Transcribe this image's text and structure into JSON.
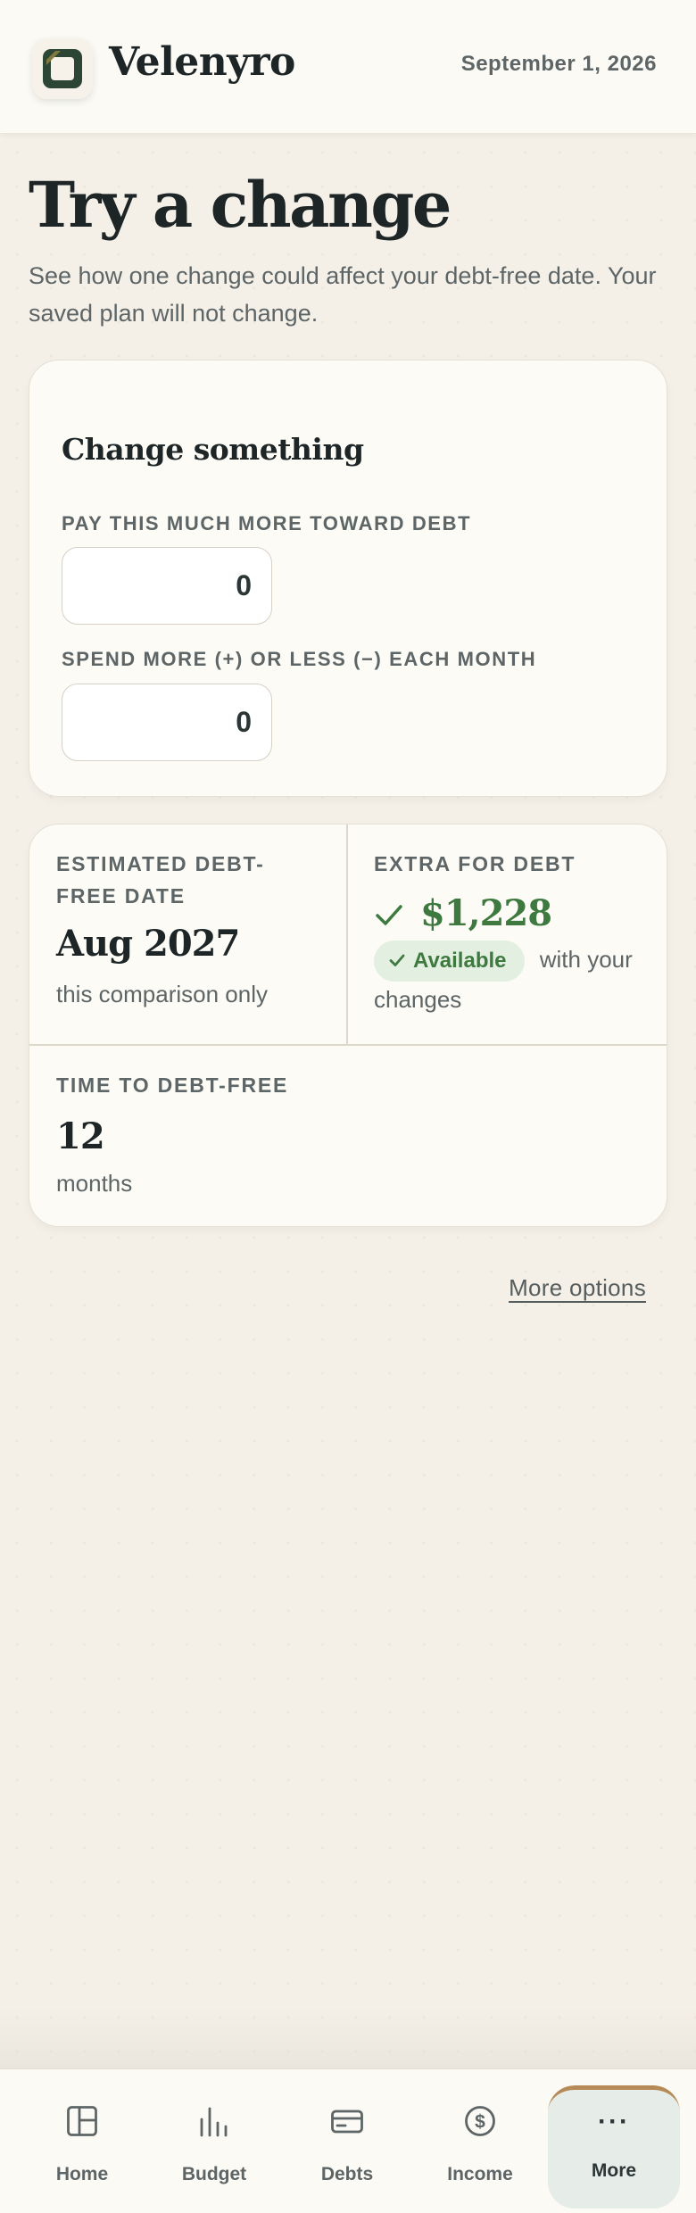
{
  "header": {
    "brand": "Velenyro",
    "date": "September 1, 2026",
    "logo_icon": "app-logo-icon"
  },
  "intro": {
    "title": "Try a change",
    "description": "See how one change could affect your debt-free date. Your saved plan will not change."
  },
  "change_card": {
    "title": "Change something",
    "extra_payment": {
      "label": "PAY THIS MUCH MORE TOWARD DEBT",
      "value": "0"
    },
    "spending_change": {
      "label": "SPEND MORE (+) OR LESS (−) EACH MONTH",
      "value": "0"
    }
  },
  "results": {
    "debt_free_date": {
      "label": "ESTIMATED DEBT-FREE DATE",
      "value": "Aug 2027",
      "note": "this comparison only"
    },
    "extra_for_debt": {
      "label": "EXTRA FOR DEBT",
      "value": "$1,228",
      "badge": "Available",
      "note": "with your changes"
    },
    "time_to_debt_free": {
      "label": "TIME TO DEBT-FREE",
      "value": "12",
      "unit": "months"
    }
  },
  "more_options": "More options",
  "nav": [
    {
      "label": "Home",
      "icon": "home-icon",
      "active": false
    },
    {
      "label": "Budget",
      "icon": "budget-chart-icon",
      "active": false
    },
    {
      "label": "Debts",
      "icon": "credit-card-icon",
      "active": false
    },
    {
      "label": "Income",
      "icon": "dollar-coin-icon",
      "active": false
    },
    {
      "label": "More",
      "icon": "more-dots-icon",
      "active": true
    }
  ],
  "colors": {
    "background": "#f4f0e8",
    "card": "#fcfbf6",
    "text": "#1d2526",
    "muted": "#5d6566",
    "accent_green": "#3e7a3f",
    "badge_bg": "#e3efe1",
    "active_nav_bg": "#e6ece8",
    "active_nav_accent": "#b68a56"
  }
}
